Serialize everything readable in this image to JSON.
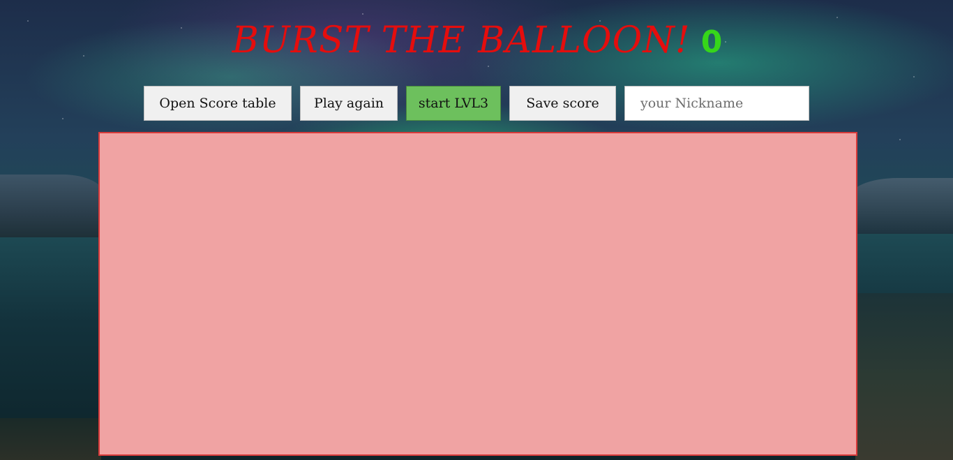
{
  "header": {
    "title": "Burst the Balloon!",
    "score": "0",
    "title_color": "#e50d0d",
    "score_color": "#36d61a"
  },
  "controls": {
    "open_score_table_label": "Open Score table",
    "play_again_label": "Play again",
    "start_level_label": "start LVL3",
    "save_score_label": "Save score",
    "nickname_placeholder": "your Nickname",
    "nickname_value": "",
    "start_level_color": "#6dc05d"
  },
  "game_area": {
    "background_color": "#f0a3a3",
    "border_color": "#d83a3a"
  }
}
